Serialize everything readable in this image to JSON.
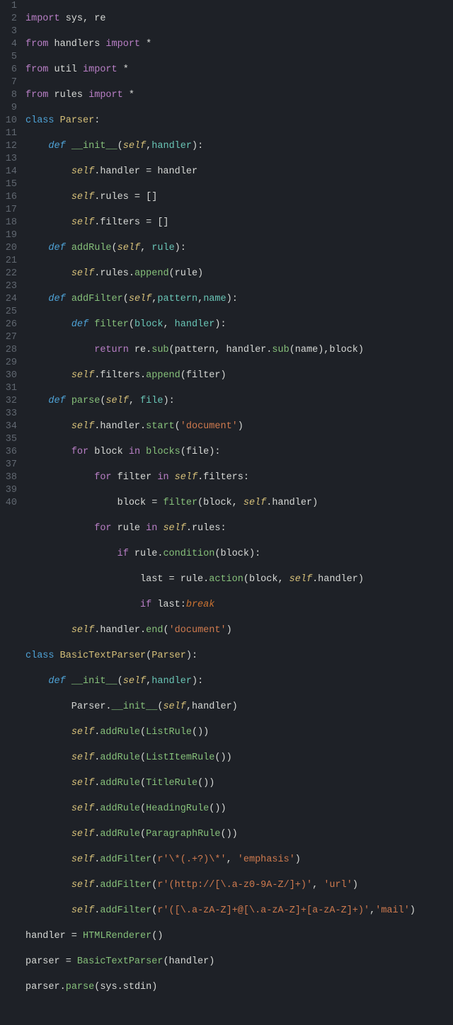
{
  "line_numbers": [
    "1",
    "2",
    "3",
    "4",
    "5",
    "6",
    "7",
    "8",
    "9",
    "10",
    "11",
    "12",
    "13",
    "14",
    "15",
    "16",
    "17",
    "18",
    "19",
    "20",
    "21",
    "22",
    "23",
    "24",
    "25",
    "26",
    "27",
    "28",
    "29",
    "30",
    "31",
    "32",
    "33",
    "34",
    "35",
    "36",
    "37",
    "38",
    "39",
    "40"
  ],
  "code": {
    "l1": {
      "a": "import",
      "b": " sys, re"
    },
    "l2": {
      "a": "from",
      "b": " handlers ",
      "c": "import",
      "d": " *"
    },
    "l3": {
      "a": "from",
      "b": " util ",
      "c": "import",
      "d": " *"
    },
    "l4": {
      "a": "from",
      "b": " rules ",
      "c": "import",
      "d": " *"
    },
    "l5": {
      "a": "class",
      "b": " ",
      "c": "Parser",
      "d": ":"
    },
    "l6": {
      "a": "    ",
      "b": "def",
      "c": " ",
      "d": "__init__",
      "e": "(",
      "f": "self",
      "g": ",",
      "h": "handler",
      "i": "):"
    },
    "l7": {
      "a": "        ",
      "b": "self",
      "c": ".handler = handler"
    },
    "l8": {
      "a": "        ",
      "b": "self",
      "c": ".rules = []"
    },
    "l9": {
      "a": "        ",
      "b": "self",
      "c": ".filters = []"
    },
    "l10": {
      "a": "    ",
      "b": "def",
      "c": " ",
      "d": "addRule",
      "e": "(",
      "f": "self",
      "g": ", ",
      "h": "rule",
      "i": "):"
    },
    "l11": {
      "a": "        ",
      "b": "self",
      "c": ".rules.",
      "d": "append",
      "e": "(rule)"
    },
    "l12": {
      "a": "    ",
      "b": "def",
      "c": " ",
      "d": "addFilter",
      "e": "(",
      "f": "self",
      "g": ",",
      "h": "pattern",
      "i": ",",
      "j": "name",
      "k": "):"
    },
    "l13": {
      "a": "        ",
      "b": "def",
      "c": " ",
      "d": "filter",
      "e": "(",
      "f": "block",
      "g": ", ",
      "h": "handler",
      "i": "):"
    },
    "l14": {
      "a": "            ",
      "b": "return",
      "c": " re.",
      "d": "sub",
      "e": "(pattern, handler.",
      "f": "sub",
      "g": "(name),block)"
    },
    "l15": {
      "a": "        ",
      "b": "self",
      "c": ".filters.",
      "d": "append",
      "e": "(filter)"
    },
    "l16": {
      "a": "    ",
      "b": "def",
      "c": " ",
      "d": "parse",
      "e": "(",
      "f": "self",
      "g": ", ",
      "h": "file",
      "i": "):"
    },
    "l17": {
      "a": "        ",
      "b": "self",
      "c": ".handler.",
      "d": "start",
      "e": "(",
      "f": "'document'",
      "g": ")"
    },
    "l18": {
      "a": "        ",
      "b": "for",
      "c": " block ",
      "d": "in",
      "e": " ",
      "f": "blocks",
      "g": "(file):"
    },
    "l19": {
      "a": "            ",
      "b": "for",
      "c": " filter ",
      "d": "in",
      "e": " ",
      "f": "self",
      "g": ".filters:"
    },
    "l20": {
      "a": "                block = ",
      "b": "filter",
      "c": "(block, ",
      "d": "self",
      "e": ".handler)"
    },
    "l21": {
      "a": "            ",
      "b": "for",
      "c": " rule ",
      "d": "in",
      "e": " ",
      "f": "self",
      "g": ".rules:"
    },
    "l22": {
      "a": "                ",
      "b": "if",
      "c": " rule.",
      "d": "condition",
      "e": "(block):"
    },
    "l23": {
      "a": "                    last = rule.",
      "b": "action",
      "c": "(block, ",
      "d": "self",
      "e": ".handler)"
    },
    "l24": {
      "a": "                    ",
      "b": "if",
      "c": " last:",
      "d": "break"
    },
    "l25": {
      "a": "        ",
      "b": "self",
      "c": ".handler.",
      "d": "end",
      "e": "(",
      "f": "'document'",
      "g": ")"
    },
    "l26": {
      "a": "class",
      "b": " ",
      "c": "BasicTextParser",
      "d": "(",
      "e": "Parser",
      "f": "):"
    },
    "l27": {
      "a": "    ",
      "b": "def",
      "c": " ",
      "d": "__init__",
      "e": "(",
      "f": "self",
      "g": ",",
      "h": "handler",
      "i": "):"
    },
    "l28": {
      "a": "        Parser.",
      "b": "__init__",
      "c": "(",
      "d": "self",
      "e": ",handler)"
    },
    "l29": {
      "a": "        ",
      "b": "self",
      "c": ".",
      "d": "addRule",
      "e": "(",
      "f": "ListRule",
      "g": "())"
    },
    "l30": {
      "a": "        ",
      "b": "self",
      "c": ".",
      "d": "addRule",
      "e": "(",
      "f": "ListItemRule",
      "g": "())"
    },
    "l31": {
      "a": "        ",
      "b": "self",
      "c": ".",
      "d": "addRule",
      "e": "(",
      "f": "TitleRule",
      "g": "())"
    },
    "l32": {
      "a": "        ",
      "b": "self",
      "c": ".",
      "d": "addRule",
      "e": "(",
      "f": "HeadingRule",
      "g": "())"
    },
    "l33": {
      "a": "        ",
      "b": "self",
      "c": ".",
      "d": "addRule",
      "e": "(",
      "f": "ParagraphRule",
      "g": "())"
    },
    "l34": {
      "a": "        ",
      "b": "self",
      "c": ".",
      "d": "addFilter",
      "e": "(",
      "f": "r'\\*(.+?)\\*'",
      "g": ", ",
      "h": "'emphasis'",
      "i": ")"
    },
    "l35": {
      "a": "        ",
      "b": "self",
      "c": ".",
      "d": "addFilter",
      "e": "(",
      "f": "r'(http://[\\.a-z0-9A-Z/]+)'",
      "g": ", ",
      "h": "'url'",
      "i": ")"
    },
    "l36": {
      "a": "        ",
      "b": "self",
      "c": ".",
      "d": "addFilter",
      "e": "(",
      "f": "r'([\\.a-zA-Z]+@[\\.a-zA-Z]+[a-zA-Z]+)'",
      "g": ",",
      "h": "'mail'",
      "i": ")"
    },
    "l37": {
      "a": "handler = ",
      "b": "HTMLRenderer",
      "c": "()"
    },
    "l38": {
      "a": "parser = ",
      "b": "BasicTextParser",
      "c": "(handler)"
    },
    "l39": {
      "a": "parser.",
      "b": "parse",
      "c": "(sys.stdin)"
    },
    "l40": {
      "a": ""
    }
  }
}
